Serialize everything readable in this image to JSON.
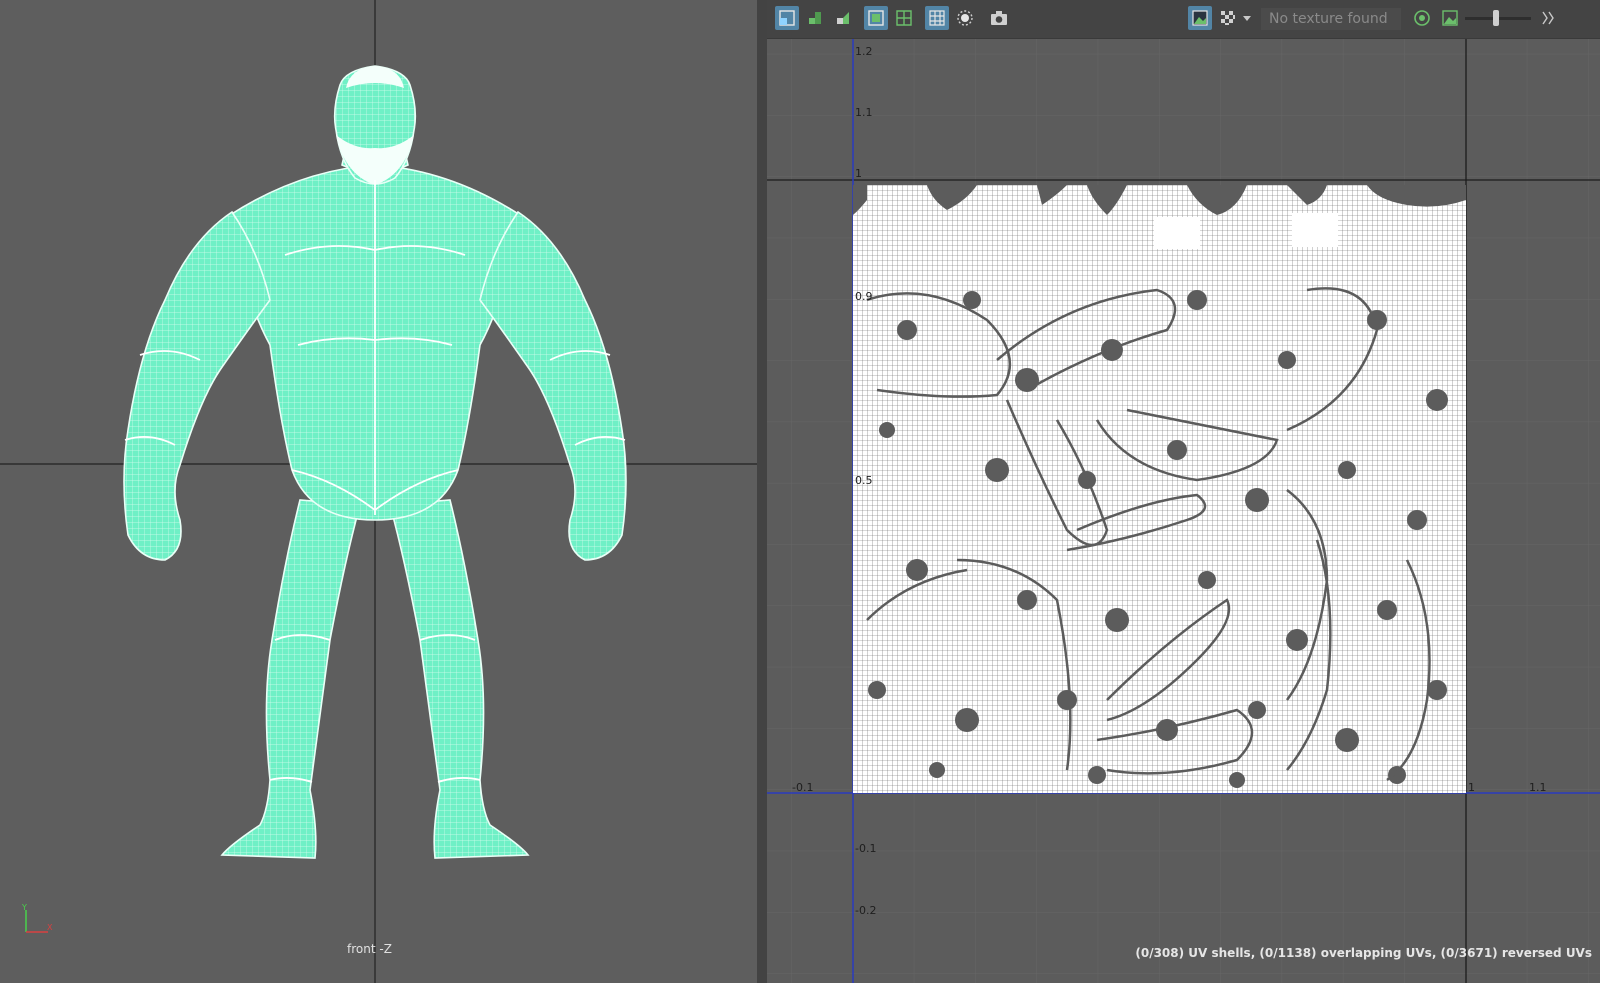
{
  "viewport": {
    "view_label": "front -Z",
    "axis_gizmo": {
      "y_label": "Y",
      "x_label": "X"
    }
  },
  "uv_editor": {
    "toolbar": {
      "texture_field_text": "No texture found",
      "buttons": [
        {
          "name": "uv-shell-icon",
          "active": true
        },
        {
          "name": "uv-layout-icon",
          "active": false
        },
        {
          "name": "uv-unfold-icon",
          "active": false
        },
        {
          "name": "frame-uv-icon",
          "active": true
        },
        {
          "name": "uv-grid-icon",
          "active": false
        },
        {
          "name": "pixel-snap-icon",
          "active": true
        },
        {
          "name": "shaded-uv-icon",
          "active": false
        },
        {
          "name": "camera-icon",
          "active": false
        },
        {
          "name": "display-image-icon",
          "active": true
        },
        {
          "name": "checker-icon",
          "active": false
        },
        {
          "name": "rgb-channels-icon",
          "active": false
        },
        {
          "name": "image-ratio-icon",
          "active": false
        }
      ]
    },
    "tick_labels": {
      "v": [
        "1.2",
        "1.1",
        "1",
        "0.9",
        "0.5",
        "-0.1",
        "-0.2"
      ],
      "u": [
        "-0.1",
        "1",
        "1.1"
      ]
    },
    "status": "(0/308) UV shells, (0/1138) overlapping UVs, (0/3671) reversed UVs"
  },
  "colors": {
    "wireframe": "#6ff0c6",
    "uv_shells": "#ffffff",
    "u_axis": "#2a3bbf",
    "v_axis": "#2a3bbf",
    "viewport_bg": "#5e5e5e",
    "toolbar_bg": "#444444"
  }
}
